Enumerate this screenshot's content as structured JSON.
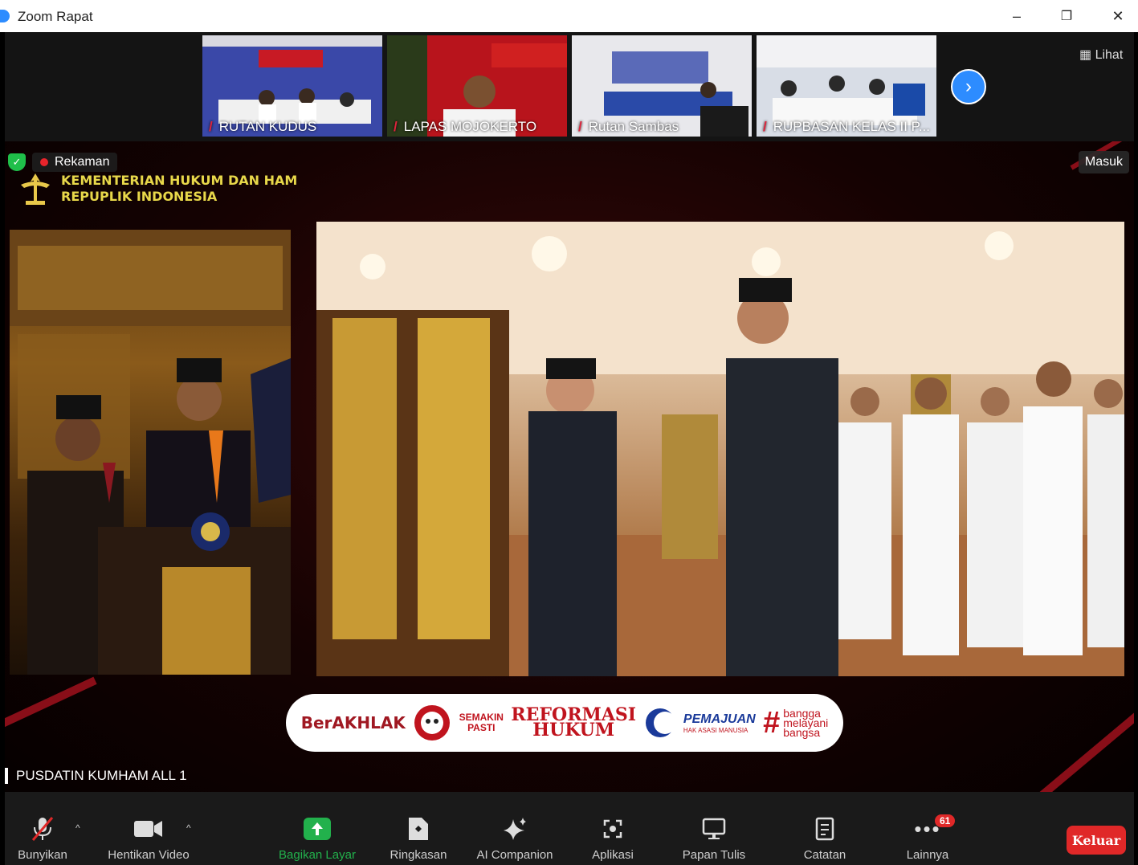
{
  "window": {
    "title": "Zoom Rapat",
    "minimize": "–",
    "restore": "❐",
    "close": "✕"
  },
  "thumbnails": [
    {
      "name": "RUTAN KUDUS",
      "bg": "#3a48a8"
    },
    {
      "name": "LAPAS MOJOKERTO",
      "bg": "#b8141c"
    },
    {
      "name": "Rutan Sambas",
      "bg": "#5a6ab8"
    },
    {
      "name": "RUPBASAN KELAS II P...",
      "bg": "#d8dde6"
    }
  ],
  "view_button": "Lihat",
  "recording_label": "Rekaman",
  "enter_button": "Masuk",
  "organization": {
    "line1": "KEMENTERIAN HUKUM DAN HAM",
    "line2": "REPUPLIK INDONESIA"
  },
  "banner": {
    "berakhlak": "BerAKHLAK",
    "semakin": "SEMAKIN",
    "pasti": "PASTI",
    "reformasi": "REFORMASI",
    "hukum": "HUKUM",
    "pemajuan": "PEMAJUAN",
    "pemajuan_sub": "HAK ASASI MANUSIA",
    "bangga1": "bangga",
    "bangga2": "melayani",
    "bangga3": "bangsa"
  },
  "active_speaker": "PUSDATIN KUMHAM ALL 1",
  "toolbar": {
    "unmute": "Bunyikan",
    "stop_video": "Hentikan Video",
    "share_screen": "Bagikan Layar",
    "summary": "Ringkasan",
    "ai_companion": "AI Companion",
    "apps": "Aplikasi",
    "whiteboard": "Papan Tulis",
    "notes": "Catatan",
    "more": "Lainnya",
    "more_badge": "61",
    "leave": "Keluar"
  },
  "colors": {
    "accent": "#2d8cff",
    "share_green": "#22b14c",
    "leave_red": "#e02828",
    "recording_red": "#e8242b"
  }
}
